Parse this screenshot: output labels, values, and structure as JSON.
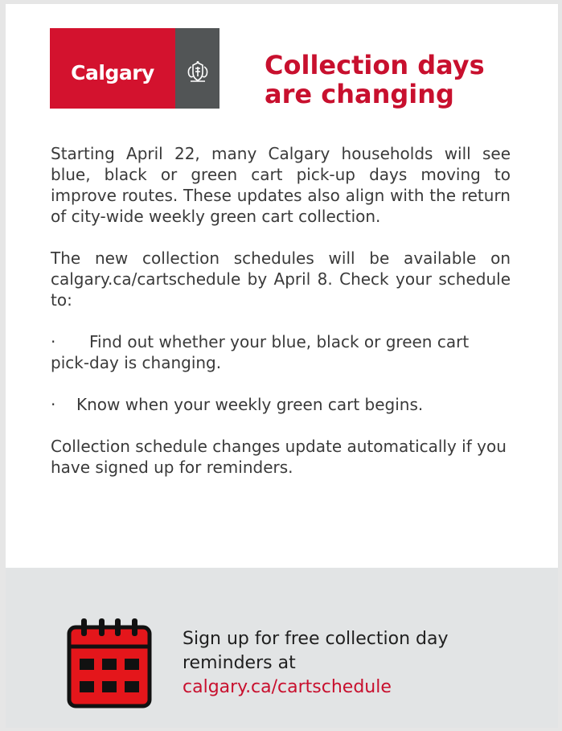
{
  "logo": {
    "wordmark": "Calgary",
    "emblem": "city-coat-of-arms-icon"
  },
  "headline": {
    "line1": "Collection days",
    "line2": "are changing"
  },
  "body": {
    "paragraph1": "Starting April 22, many Calgary households will see blue, black or green cart pick-up days moving to improve routes. These updates also align with the return of city-wide weekly green cart collection.",
    "paragraph2": "The new collection schedules will be available on calgary.ca/cartschedule by April 8. Check your schedule to:",
    "bullets": [
      {
        "marker": "·",
        "text": "Find out whether your blue, black or green cart pick-day is changing."
      },
      {
        "marker": "·",
        "text": "Know when your weekly green cart begins."
      }
    ],
    "paragraph3": "Collection schedule changes update automatically if you have signed up for reminders."
  },
  "footer": {
    "icon": "calendar-icon",
    "text": "Sign up for free collection day reminders at",
    "link": "calgary.ca/cartschedule"
  },
  "colors": {
    "brand_red": "#c8102e",
    "logo_red": "#d3122e",
    "logo_gray": "#525556",
    "footer_bg": "#e2e4e5",
    "page_bg": "#e6e6e6"
  }
}
